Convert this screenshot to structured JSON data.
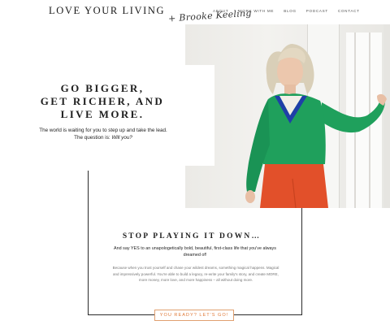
{
  "header": {
    "logo_main": "LOVE YOUR LIVING",
    "logo_script": "+ Brooke Keeling",
    "nav": [
      "ABOUT",
      "WORK WITH ME",
      "BLOG",
      "PODCAST",
      "CONTACT"
    ]
  },
  "hero": {
    "heading_lines": [
      "GO BIGGER,",
      "GET RICHER, AND",
      "LIVE MORE."
    ],
    "subtext_line1": "The world is waiting for you to step up and take the lead.",
    "subtext_line2_prefix": "The question is: ",
    "subtext_line2_emphasis": "Will you?"
  },
  "section": {
    "heading": "STOP PLAYING IT DOWN…",
    "subheading": "And say YES to an unapologetically bold, beautiful, first-class life that you've always dreamed of!",
    "body": "Because when you trust yourself and chase your wildest dreams, something magical happens. Magical and impressively powerful. You're able to build a legacy, re-write your family's story, and create MORE, more money, more love, and more happiness – all without doing more.",
    "cta_label": "YOU READY? LET'S GO!"
  },
  "colors": {
    "accent": "#e07a3a",
    "sweater_green": "#1fa05c",
    "pants_orange": "#e2502a"
  }
}
